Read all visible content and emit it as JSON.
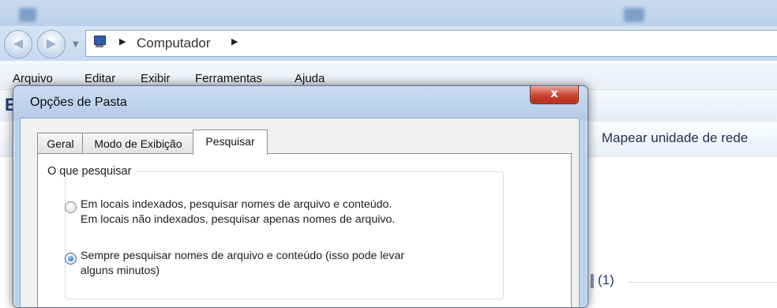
{
  "explorer": {
    "address": {
      "location": "Computador"
    },
    "menu": [
      "Arquivo",
      "Editar",
      "Exibir",
      "Ferramentas",
      "Ajuda"
    ],
    "command_bar": {
      "map_network_drive": "Mapear unidade de rede"
    },
    "content": {
      "group_count": "(1)"
    }
  },
  "dialog": {
    "title": "Opções de Pasta",
    "close_glyph": "x",
    "tabs": [
      {
        "label": "Geral",
        "active": false
      },
      {
        "label": "Modo de Exibição",
        "active": false
      },
      {
        "label": "Pesquisar",
        "active": true
      }
    ],
    "search_group": {
      "legend": "O que pesquisar",
      "options": [
        {
          "line1": "Em locais indexados, pesquisar nomes de arquivo e conteúdo.",
          "line2": "Em locais não indexados, pesquisar apenas nomes de arquivo.",
          "selected": false
        },
        {
          "line1": "Sempre pesquisar nomes de arquivo e conteúdo (isso pode levar",
          "line2": "alguns minutos)",
          "selected": true
        }
      ]
    }
  },
  "colors": {
    "title_glass": "#c9dbee",
    "close_button": "#c9432f",
    "radio_selected": "#1f5ea8"
  }
}
